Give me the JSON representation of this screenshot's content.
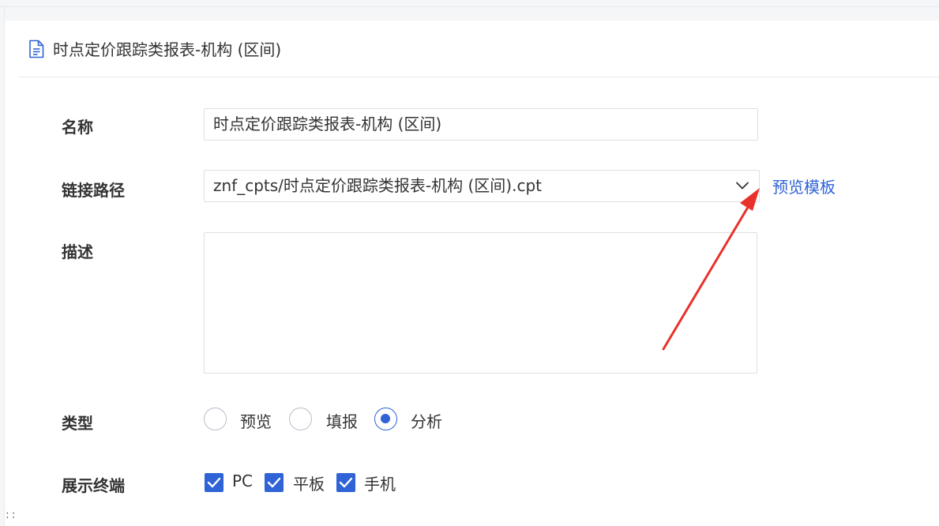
{
  "header": {
    "icon": "document-icon",
    "title": "时点定价跟踪类报表-机构 (区间)"
  },
  "form": {
    "name": {
      "label": "名称",
      "value": "时点定价跟踪类报表-机构 (区间)"
    },
    "link_path": {
      "label": "链接路径",
      "value": "znf_cpts/时点定价跟踪类报表-机构 (区间).cpt",
      "action_label": "预览模板"
    },
    "description": {
      "label": "描述",
      "value": ""
    },
    "type": {
      "label": "类型",
      "options": [
        {
          "label": "预览",
          "checked": false
        },
        {
          "label": "填报",
          "checked": false
        },
        {
          "label": "分析",
          "checked": true
        }
      ]
    },
    "terminals": {
      "label": "展示终端",
      "options": [
        {
          "label": "PC",
          "checked": true
        },
        {
          "label": "平板",
          "checked": true
        },
        {
          "label": "手机",
          "checked": true
        }
      ]
    }
  },
  "colors": {
    "accent": "#2f63d6",
    "annotation_arrow": "#e8312a"
  }
}
